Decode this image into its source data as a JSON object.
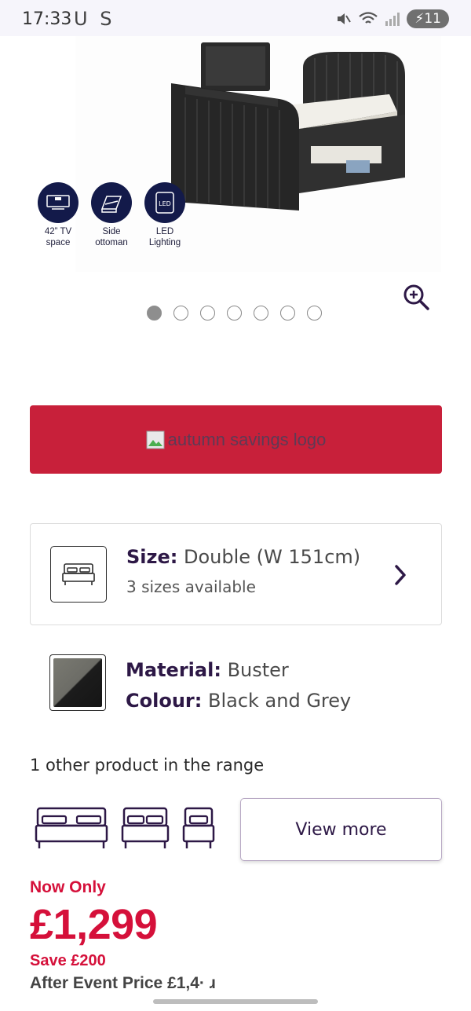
{
  "status_bar": {
    "time": "17:33",
    "carrier": "U S",
    "battery": "11"
  },
  "product_image": {
    "features": [
      {
        "icon": "tv-icon",
        "label_line1": "42” TV",
        "label_line2": "space"
      },
      {
        "icon": "bed-ottoman-icon",
        "label_line1": "Side",
        "label_line2": "ottoman"
      },
      {
        "icon": "led-icon",
        "label_line1": "LED",
        "label_line2": "Lighting"
      }
    ],
    "carousel_count": 7,
    "carousel_active": 0
  },
  "promo": {
    "alt_text": "autumn savings logo",
    "background": "#c8203a"
  },
  "size": {
    "label": "Size:",
    "value": "Double (W 151cm)",
    "sub": "3 sizes available"
  },
  "material": {
    "material_label": "Material:",
    "material_value": "Buster",
    "colour_label": "Colour:",
    "colour_value": "Black and Grey"
  },
  "range": {
    "text": "1 other product in the range",
    "view_more": "View more"
  },
  "pricing": {
    "now_only": "Now Only",
    "price": "£1,299",
    "save": "Save £200",
    "after_event": "After Event Price £1,4· ɹ"
  },
  "colors": {
    "accent_red": "#d5103a",
    "brand_purple": "#2d1846"
  }
}
